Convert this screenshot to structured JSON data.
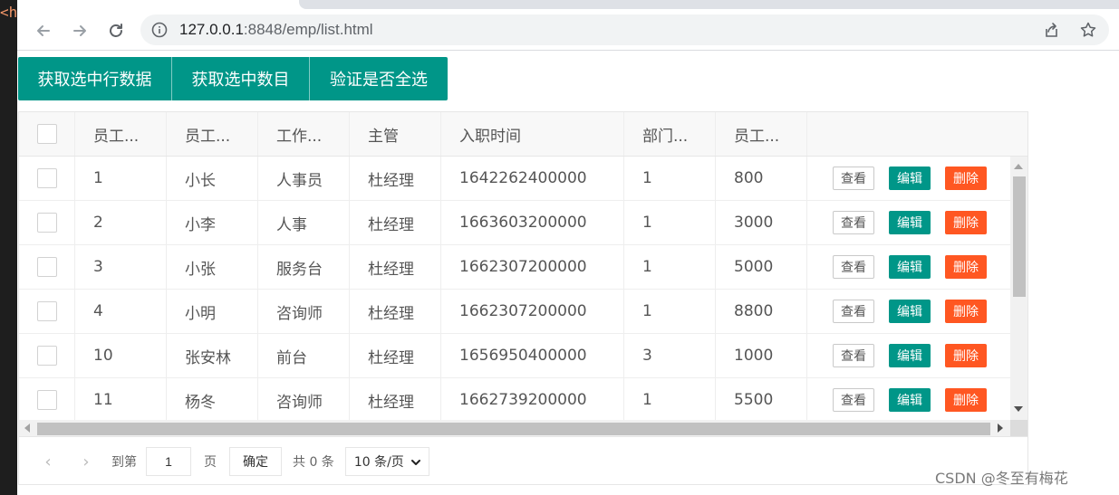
{
  "editor_fragment": "<h",
  "browser": {
    "url_host": "127.0.0.1",
    "url_path": ":8848/emp/list.html"
  },
  "toolbar_buttons": [
    {
      "label": "获取选中行数据"
    },
    {
      "label": "获取选中数目"
    },
    {
      "label": "验证是否全选"
    }
  ],
  "table": {
    "headers": [
      "员工...",
      "员工...",
      "工作...",
      "主管",
      "入职时间",
      "部门...",
      "员工..."
    ],
    "rows": [
      [
        "1",
        "小长",
        "人事员",
        "杜经理",
        "1642262400000",
        "1",
        "800"
      ],
      [
        "2",
        "小李",
        "人事",
        "杜经理",
        "1663603200000",
        "1",
        "3000"
      ],
      [
        "3",
        "小张",
        "服务台",
        "杜经理",
        "1662307200000",
        "1",
        "5000"
      ],
      [
        "4",
        "小明",
        "咨询师",
        "杜经理",
        "1662307200000",
        "1",
        "8800"
      ],
      [
        "10",
        "张安林",
        "前台",
        "杜经理",
        "1656950400000",
        "3",
        "1000"
      ],
      [
        "11",
        "杨冬",
        "咨询师",
        "杜经理",
        "1662739200000",
        "1",
        "5500"
      ]
    ],
    "actions": {
      "view": "查看",
      "edit": "编辑",
      "delete": "删除"
    }
  },
  "pager": {
    "goto_label": "到第",
    "page_value": "1",
    "page_unit": "页",
    "confirm_label": "确定",
    "total_text": "共 0 条",
    "page_size": "10 条/页"
  },
  "watermark": "CSDN @冬至有梅花",
  "colors": {
    "primary": "#009688",
    "danger": "#ff5722"
  }
}
